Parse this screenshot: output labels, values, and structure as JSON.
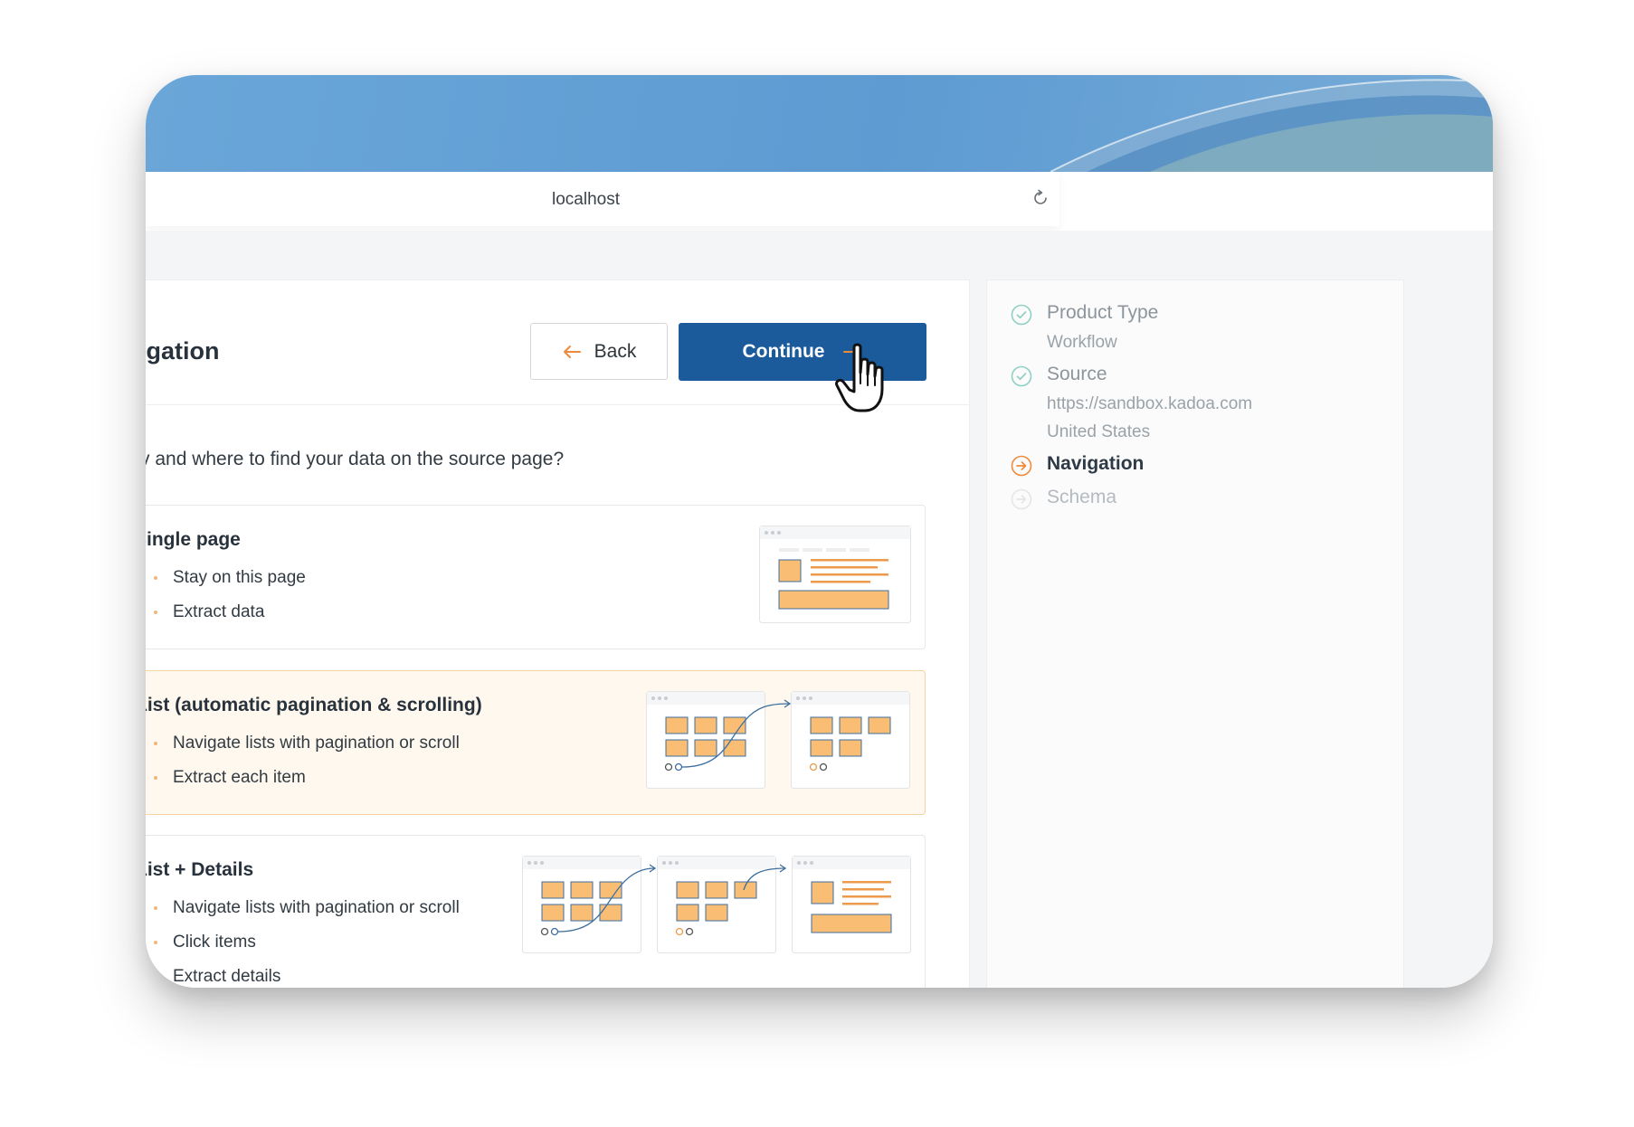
{
  "browser": {
    "address": "localhost",
    "reload_icon": "reload-icon"
  },
  "header": {
    "title": "vigation",
    "back_label": "Back",
    "continue_label": "Continue"
  },
  "question": "v and where to find your data on the source page?",
  "options": [
    {
      "title": "Single page",
      "items": [
        "Stay on this page",
        "Extract data"
      ],
      "selected": false
    },
    {
      "title": "List (automatic pagination & scrolling)",
      "items": [
        "Navigate lists with pagination or scroll",
        "Extract each item"
      ],
      "selected": true
    },
    {
      "title": "List + Details",
      "items": [
        "Navigate lists with pagination or scroll",
        "Click items",
        "Extract details"
      ],
      "selected": false
    }
  ],
  "steps": [
    {
      "label": "Product Type",
      "details": [
        "Workflow"
      ],
      "status": "complete"
    },
    {
      "label": "Source",
      "details": [
        "https://sandbox.kadoa.com",
        "United States"
      ],
      "status": "complete"
    },
    {
      "label": "Navigation",
      "details": [],
      "status": "current"
    },
    {
      "label": "Schema",
      "details": [],
      "status": "upcoming"
    }
  ],
  "colors": {
    "primary": "#1b5a9b",
    "accent": "#ee8a3c",
    "success": "#8fd0c3",
    "selected_bg": "#fef8ee",
    "tile": "#f9bd74"
  }
}
